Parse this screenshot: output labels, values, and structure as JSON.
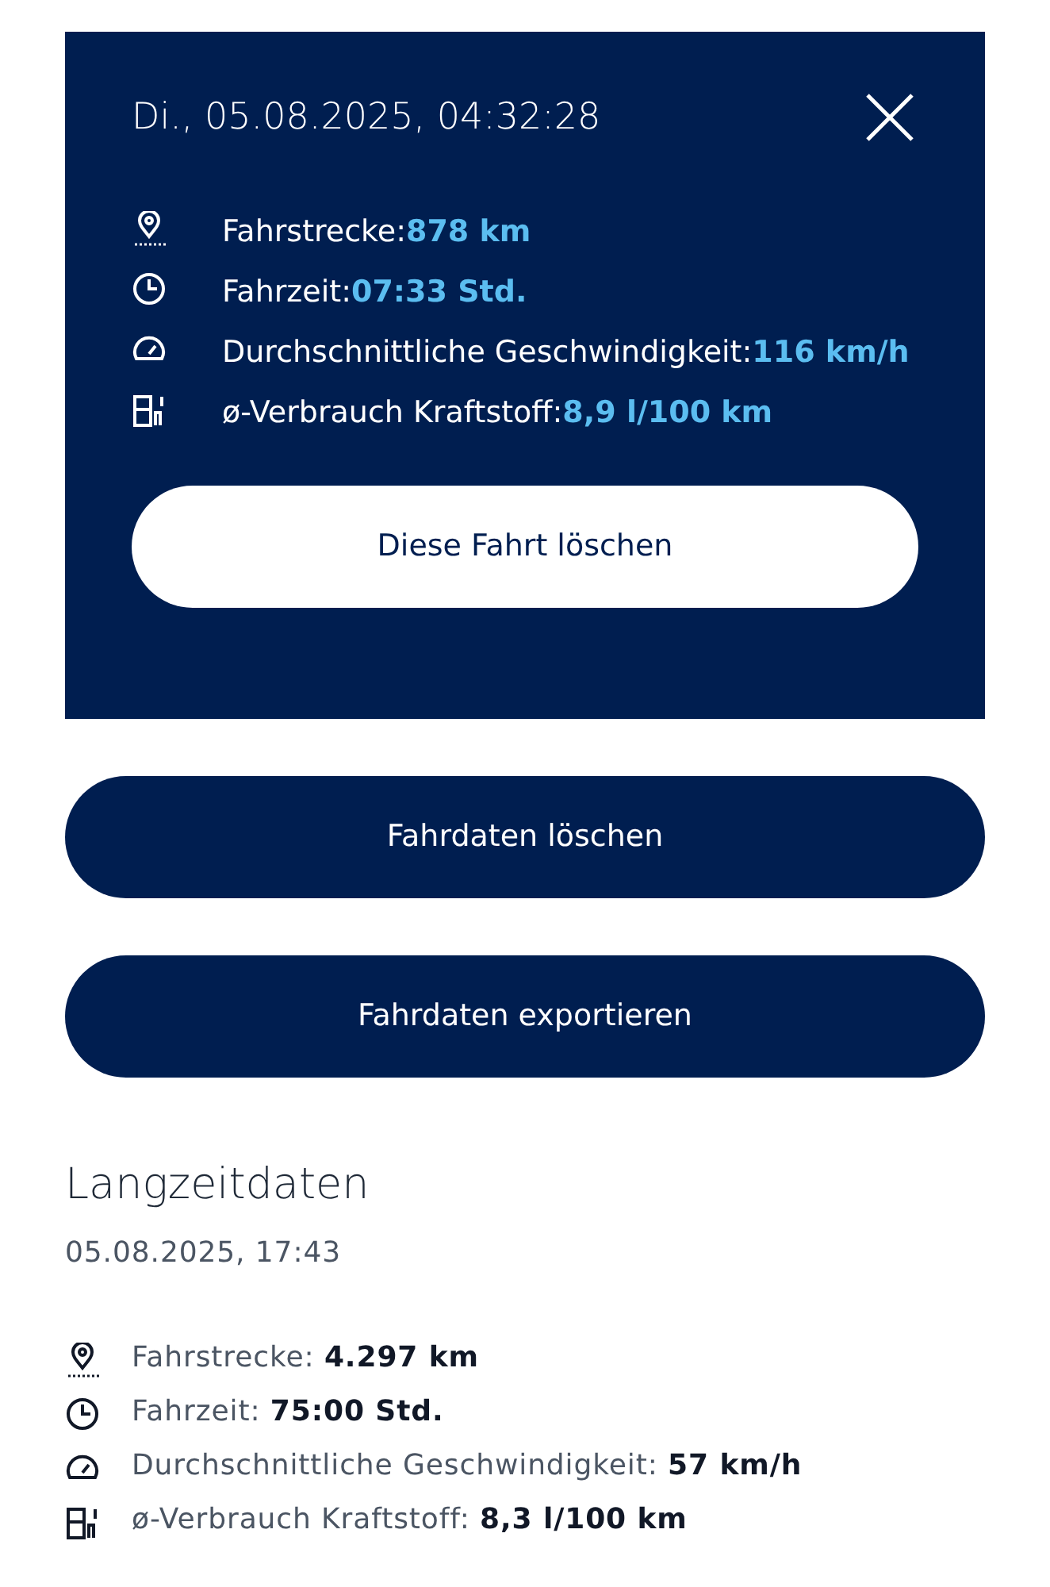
{
  "trip": {
    "title": "Di., 05.08.2025, 04:32:28",
    "stats": [
      {
        "kind": "distance",
        "label": "Fahrstrecke:",
        "value": "878 km"
      },
      {
        "kind": "time",
        "label": "Fahrzeit:",
        "value": "07:33 Std."
      },
      {
        "kind": "speed",
        "label": "Durchschnittliche Geschwindigkeit:",
        "value": "116 km/h"
      },
      {
        "kind": "fuel",
        "label": "ø-Verbrauch Kraftstoff:",
        "value": "8,9 l/100 km"
      }
    ],
    "delete_button": "Diese Fahrt löschen"
  },
  "buttons": [
    "Fahrdaten löschen",
    "Fahrdaten exportieren"
  ],
  "longterm": {
    "title": "Langzeitdaten",
    "date": "05.08.2025, 17:43",
    "stats": [
      {
        "kind": "distance",
        "label": "Fahrstrecke: ",
        "value": "4.297 km"
      },
      {
        "kind": "time",
        "label": "Fahrzeit: ",
        "value": "75:00 Std."
      },
      {
        "kind": "speed",
        "label": "Durchschnittliche Geschwindigkeit: ",
        "value": "57 km/h"
      },
      {
        "kind": "fuel",
        "label": "ø-Verbrauch Kraftstoff: ",
        "value": "8,3 l/100 km"
      }
    ]
  }
}
